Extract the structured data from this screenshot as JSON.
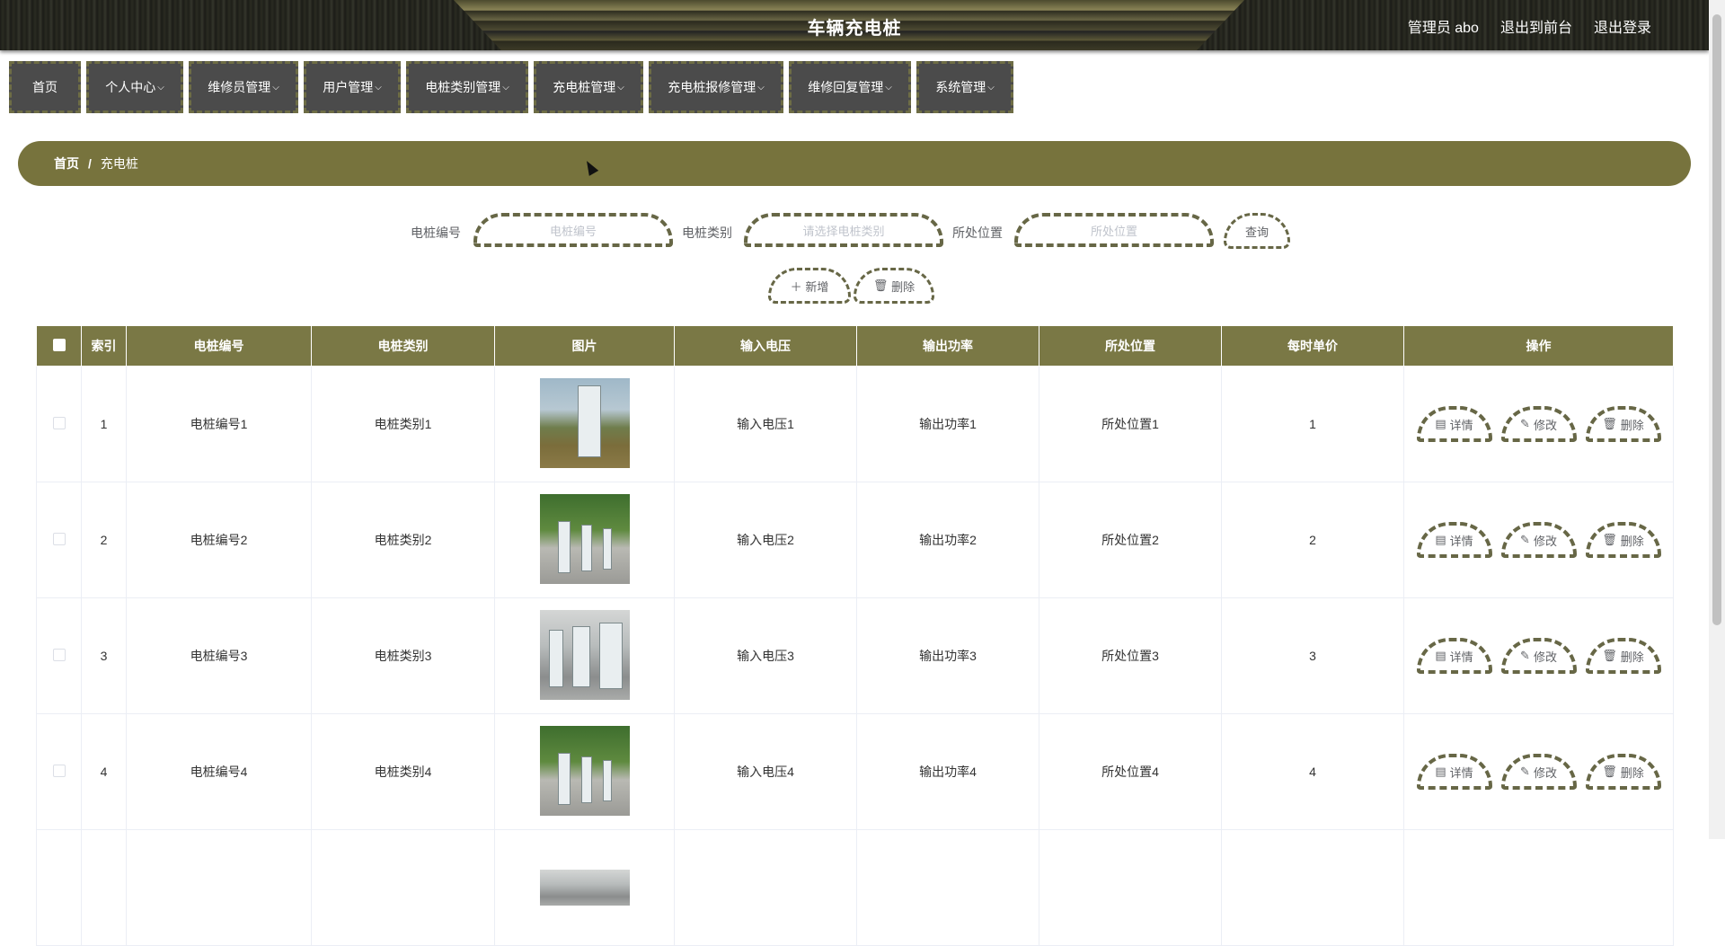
{
  "header": {
    "title": "车辆充电桩",
    "admin": "管理员 abo",
    "to_front": "退出到前台",
    "logout": "退出登录"
  },
  "nav": [
    {
      "label": "首页",
      "has_dropdown": false
    },
    {
      "label": "个人中心",
      "has_dropdown": true
    },
    {
      "label": "维修员管理",
      "has_dropdown": true
    },
    {
      "label": "用户管理",
      "has_dropdown": true
    },
    {
      "label": "电桩类别管理",
      "has_dropdown": true
    },
    {
      "label": "充电桩管理",
      "has_dropdown": true
    },
    {
      "label": "充电桩报修管理",
      "has_dropdown": true
    },
    {
      "label": "维修回复管理",
      "has_dropdown": true
    },
    {
      "label": "系统管理",
      "has_dropdown": true
    }
  ],
  "breadcrumb": {
    "home": "首页",
    "separator": "/",
    "current": "充电桩"
  },
  "search": {
    "code_label": "电桩编号",
    "code_placeholder": "电桩编号",
    "category_label": "电桩类别",
    "category_placeholder": "请选择电桩类别",
    "location_label": "所处位置",
    "location_placeholder": "所处位置",
    "query_button": "查询",
    "add_button": "新增",
    "delete_button": "删除"
  },
  "table": {
    "columns": [
      "索引",
      "电桩编号",
      "电桩类别",
      "图片",
      "输入电压",
      "输出功率",
      "所处位置",
      "每时单价",
      "操作"
    ],
    "actions": {
      "detail": "详情",
      "edit": "修改",
      "delete": "删除"
    },
    "rows": [
      {
        "index": "1",
        "code": "电桩编号1",
        "category": "电桩类别1",
        "image": "charging-station-photo",
        "voltage": "输入电压1",
        "power": "输出功率1",
        "location": "所处位置1",
        "price": "1"
      },
      {
        "index": "2",
        "code": "电桩编号2",
        "category": "电桩类别2",
        "image": "charging-station-photo",
        "voltage": "输入电压2",
        "power": "输出功率2",
        "location": "所处位置2",
        "price": "2"
      },
      {
        "index": "3",
        "code": "电桩编号3",
        "category": "电桩类别3",
        "image": "charging-station-photo",
        "voltage": "输入电压3",
        "power": "输出功率3",
        "location": "所处位置3",
        "price": "3"
      },
      {
        "index": "4",
        "code": "电桩编号4",
        "category": "电桩类别4",
        "image": "charging-station-photo",
        "voltage": "输入电压4",
        "power": "输出功率4",
        "location": "所处位置4",
        "price": "4"
      }
    ]
  },
  "colors": {
    "accent": "#77733d",
    "nav_bg": "#4b4b4b",
    "dashed_border": "#676746"
  }
}
